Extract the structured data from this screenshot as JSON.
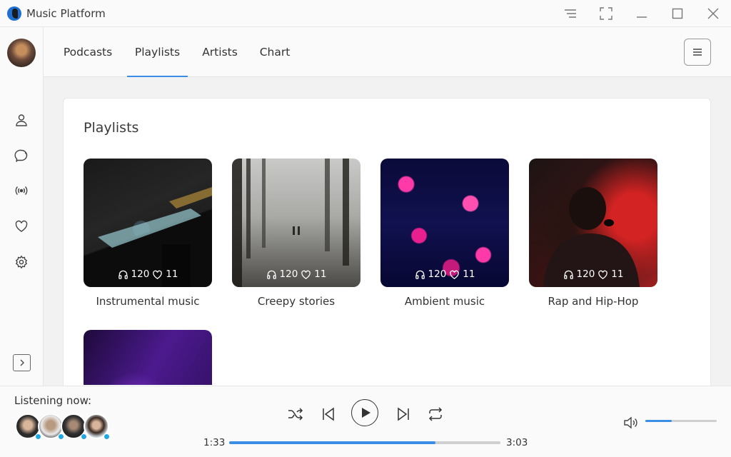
{
  "app": {
    "title": "Music Platform"
  },
  "window_controls": [
    "list-icon",
    "fullscreen-icon",
    "minimize-icon",
    "maximize-icon",
    "close-icon"
  ],
  "sidebar": {
    "icons": [
      "user-icon",
      "chat-icon",
      "broadcast-icon",
      "heart-icon",
      "gear-icon"
    ],
    "expand_icon": "chevron-right-icon"
  },
  "tabs": [
    {
      "label": "Podcasts",
      "active": false
    },
    {
      "label": "Playlists",
      "active": true
    },
    {
      "label": "Artists",
      "active": false
    },
    {
      "label": "Chart",
      "active": false
    }
  ],
  "main": {
    "section_title": "Playlists",
    "playlists": [
      {
        "title": "Instrumental music",
        "listens": "120",
        "likes": "11"
      },
      {
        "title": "Creepy stories",
        "listens": "120",
        "likes": "11"
      },
      {
        "title": "Ambient music",
        "listens": "120",
        "likes": "11"
      },
      {
        "title": "Rap and Hip-Hop",
        "listens": "120",
        "likes": "11"
      },
      {
        "title": "",
        "listens": "",
        "likes": ""
      }
    ]
  },
  "player": {
    "listening_label": "Listening now:",
    "listeners_count": 4,
    "current_time": "1:33",
    "total_time": "3:03",
    "progress_fraction": 0.76,
    "volume_fraction": 0.37,
    "accent_color": "#3a8ee6",
    "online_dot_color": "#20a8e6"
  }
}
